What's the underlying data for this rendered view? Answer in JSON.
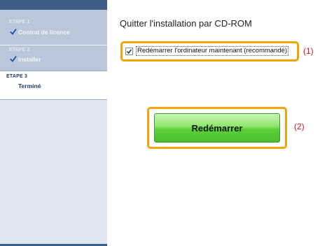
{
  "sidebar": {
    "steps": [
      {
        "number": "ETAPE 1",
        "label": "Contrat de licence",
        "status": "done"
      },
      {
        "number": "ETAPE 2",
        "label": "Installer",
        "status": "done"
      },
      {
        "number": "ETAPE 3",
        "label": "Terminé",
        "status": "current"
      }
    ]
  },
  "main": {
    "title": "Quitter l'installation par CD-ROM",
    "restart_checkbox": {
      "label": "Redémarrer l'ordinateur maintenant (recommandé)",
      "checked": true
    },
    "restart_button": {
      "label": "Redémarrer"
    },
    "annotations": [
      "(1)",
      "(2)"
    ]
  },
  "colors": {
    "sidebar_background": "#dfe6f0",
    "sidebar_bar": "#3d5c86",
    "done_step_background": "#b9c7db",
    "highlight": "#f2a40c",
    "annotation": "#d11a1a",
    "button_green": "#5ccf3b"
  }
}
